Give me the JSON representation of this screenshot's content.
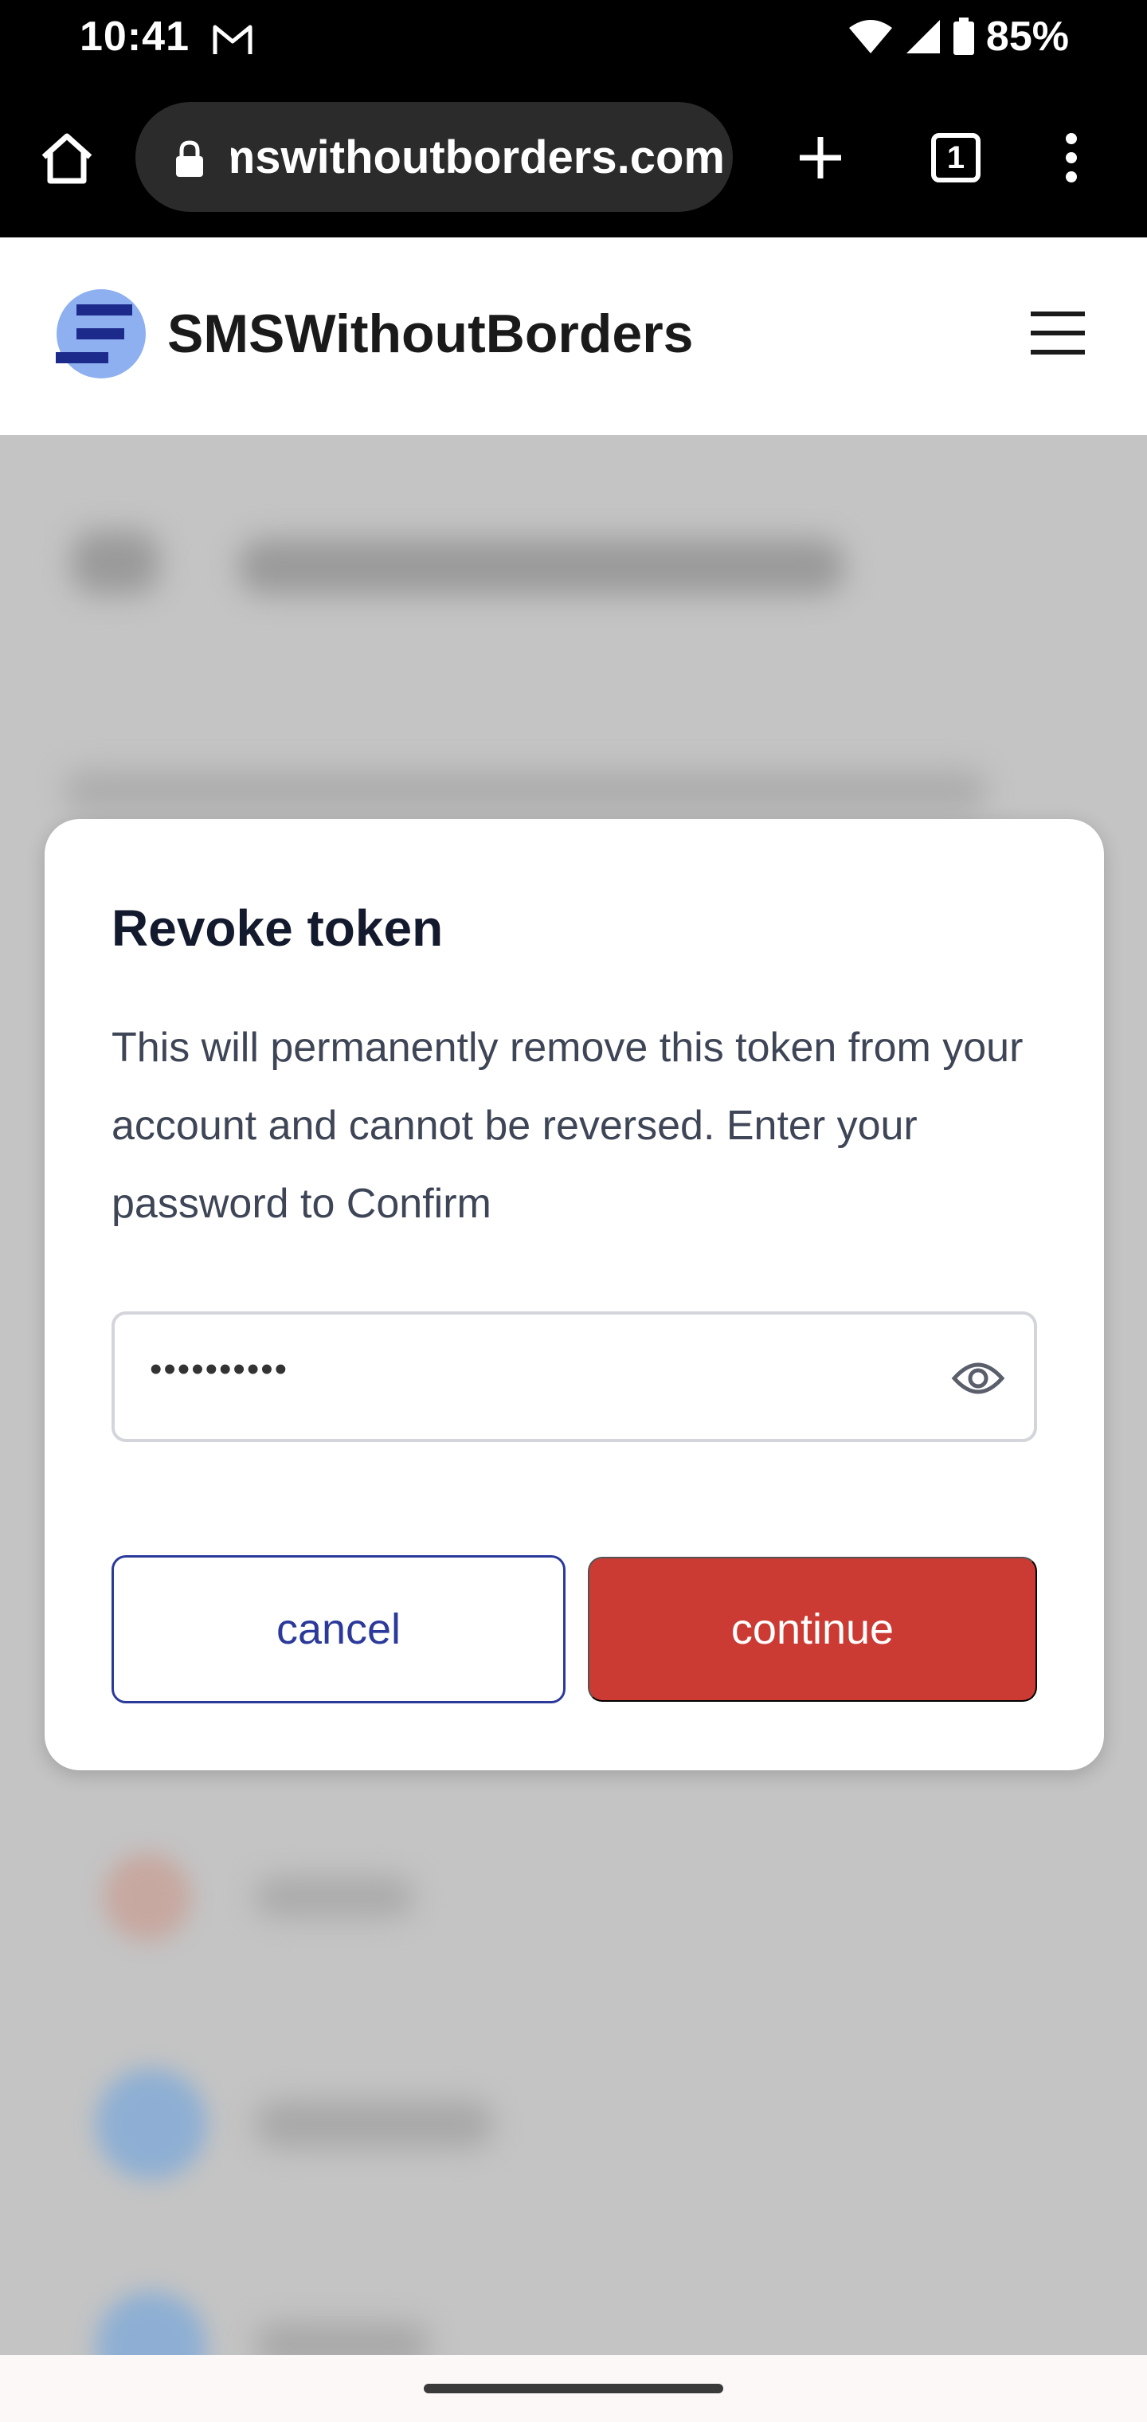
{
  "status_bar": {
    "time": "10:41",
    "battery": "85%",
    "icons": [
      "gmail-icon",
      "wifi-icon",
      "signal-icon",
      "battery-icon"
    ]
  },
  "browser": {
    "url": "smswithoutborders.com",
    "tab_count": "1",
    "icons": [
      "home-icon",
      "lock-icon",
      "plus-icon",
      "tabs-icon",
      "more-vert-icon"
    ]
  },
  "site_header": {
    "brand": "SMSWithoutBorders",
    "icons": [
      "logo-icon",
      "hamburger-menu-icon"
    ]
  },
  "modal": {
    "title": "Revoke token",
    "body": "This will permanently remove this token from your account and cannot be reversed. Enter your password to Confirm",
    "password_value": "••••••••••",
    "cancel_label": "cancel",
    "continue_label": "continue"
  },
  "colors": {
    "accent": "#2b3a9a",
    "danger": "#cb3b34",
    "overlay": "#c4c4c4",
    "logo_dark": "#1c2a8c",
    "logo_light": "#8fb0f0"
  }
}
